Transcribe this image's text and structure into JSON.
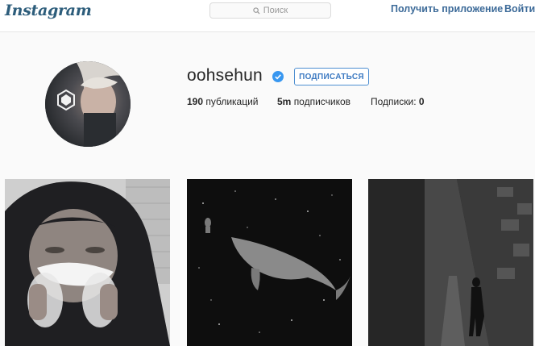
{
  "header": {
    "logo_text": "Instagram",
    "search_placeholder": "Поиск",
    "get_app_label": "Получить приложение",
    "login_label": "Войти"
  },
  "profile": {
    "username": "oohsehun",
    "verified": true,
    "follow_label": "ПОДПИСАТЬСЯ",
    "posts_count": "190",
    "posts_label": "публикаций",
    "followers_count": "5m",
    "followers_label": "подписчиков",
    "following_label": "Подписки:",
    "following_count": "0"
  },
  "colors": {
    "link_blue": "#3d6b99",
    "follow_blue": "#4e8fd1",
    "verified_blue": "#3897f0"
  },
  "icons": [
    "search-icon",
    "verified-badge-icon"
  ],
  "posts": [
    {
      "description": "person in dark hood holding cotton candy"
    },
    {
      "description": "astronaut and whale in starry space"
    },
    {
      "description": "person walking in narrow dark alley"
    }
  ]
}
